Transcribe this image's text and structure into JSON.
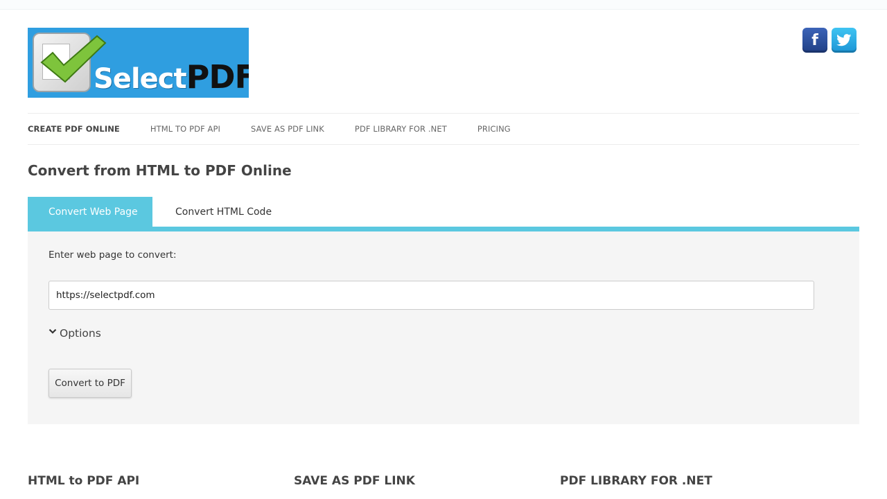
{
  "brand": {
    "logo_word_1": "Select",
    "logo_word_2": "PDF",
    "colors": {
      "logo_bg": "#2f9ee0",
      "accent": "#5bc8e0",
      "facebook": "#2d4f9e",
      "twitter": "#2aa9e6"
    }
  },
  "social": [
    {
      "name": "facebook-icon",
      "glyph": "f"
    },
    {
      "name": "twitter-icon",
      "glyph": "twitter-bird"
    }
  ],
  "nav": {
    "items": [
      {
        "label": "CREATE PDF ONLINE",
        "active": true
      },
      {
        "label": "HTML TO PDF API",
        "active": false
      },
      {
        "label": "SAVE AS PDF LINK",
        "active": false
      },
      {
        "label": "PDF LIBRARY FOR .NET",
        "active": false
      },
      {
        "label": "PRICING",
        "active": false
      }
    ]
  },
  "page": {
    "title": "Convert from HTML to PDF Online"
  },
  "tabs": [
    {
      "label": "Convert Web Page",
      "active": true
    },
    {
      "label": "Convert HTML Code",
      "active": false
    }
  ],
  "form": {
    "url_label": "Enter web page to convert:",
    "url_value": "https://selectpdf.com",
    "options_label": "Options",
    "convert_label": "Convert to PDF"
  },
  "footer": {
    "headings": [
      "HTML to PDF API",
      "SAVE AS PDF LINK",
      "PDF LIBRARY FOR .NET"
    ]
  }
}
